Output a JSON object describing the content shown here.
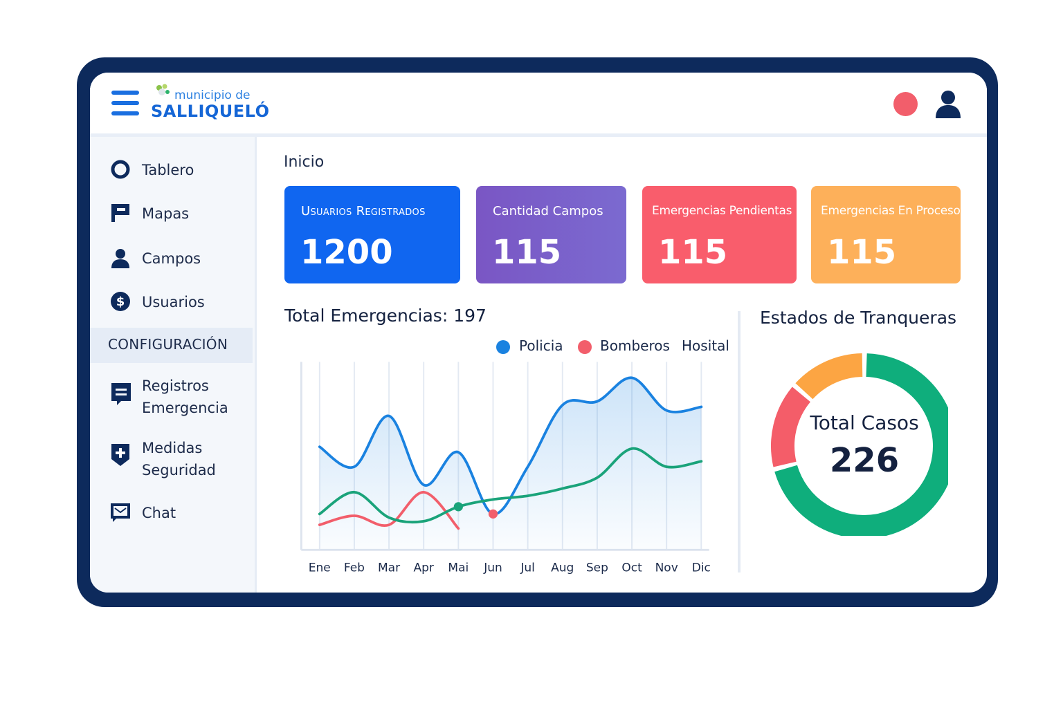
{
  "header": {
    "logo_small": "municipio de",
    "logo_big": "SALLIQUELÓ"
  },
  "sidebar": {
    "items": [
      {
        "label": "Tablero",
        "icon": "circle-icon"
      },
      {
        "label": "Mapas",
        "icon": "flag-icon"
      },
      {
        "label": "Campos",
        "icon": "user-icon"
      },
      {
        "label": "Usuarios",
        "icon": "dollar-icon"
      }
    ],
    "section": "CONFIGURACIÓN",
    "config_items": [
      {
        "label": "Registros\nEmergencia",
        "icon": "chat-list-icon"
      },
      {
        "label": "Medidas\nSeguridad",
        "icon": "shield-plus-icon"
      },
      {
        "label": "Chat",
        "icon": "message-icon"
      }
    ]
  },
  "main": {
    "title": "Inicio",
    "cards": [
      {
        "label": "Usuarios Registrados",
        "value": "1200",
        "color": "#1066f0"
      },
      {
        "label": "Cantidad Campos",
        "value": "115",
        "color": "#7a5fca"
      },
      {
        "label": "Emergencias Pendientas",
        "value": "115",
        "color": "#f95d6c"
      },
      {
        "label": "Emergencias En Proceso",
        "value": "115",
        "color": "#fdb05a"
      }
    ]
  },
  "chart_data": [
    {
      "type": "line",
      "title": "Total Emergencias: 197",
      "categories": [
        "Ene",
        "Feb",
        "Mar",
        "Apr",
        "Mai",
        "Jun",
        "Jul",
        "Aug",
        "Sep",
        "Oct",
        "Nov",
        "Dic"
      ],
      "legend": [
        "Policia",
        "Bomberos",
        "Hosital"
      ],
      "legend_colors": [
        "#1a82e0",
        "#f25e6b",
        "#1aa37a"
      ],
      "legend_placement": "top-right",
      "grid": "vertical",
      "series": [
        {
          "name": "Policia",
          "color": "#1a82e0",
          "values": [
            55,
            44,
            72,
            34,
            52,
            18,
            44,
            78,
            80,
            93,
            75,
            77
          ]
        },
        {
          "name": "Bomberos",
          "color": "#f25e6b",
          "values": [
            12,
            17,
            12,
            30,
            10
          ]
        },
        {
          "name": "Hosital",
          "color": "#1aa37a",
          "values": [
            18,
            30,
            16,
            14,
            22,
            26,
            28,
            32,
            38,
            54,
            44,
            47
          ]
        }
      ]
    },
    {
      "type": "pie",
      "title": "Estados de Tranqueras",
      "center_label": "Total Casos",
      "center_value": "226",
      "slices": [
        {
          "value": 160,
          "color": "#0fae7c"
        },
        {
          "value": 35,
          "color": "#f45d69"
        },
        {
          "value": 31,
          "color": "#fca543"
        }
      ]
    }
  ]
}
